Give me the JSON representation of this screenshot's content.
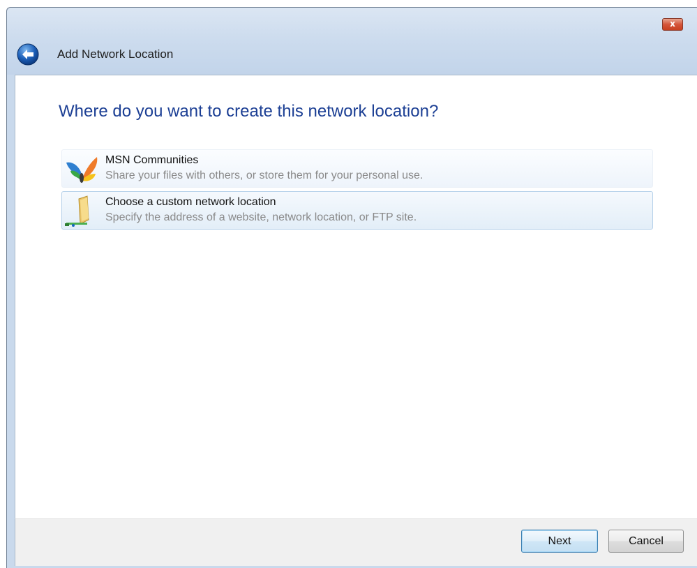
{
  "window": {
    "title": "Add Network Location",
    "close_label": "x"
  },
  "content": {
    "heading": "Where do you want to create this network location?",
    "options": [
      {
        "title": "MSN Communities",
        "description": "Share your files with others, or store them for your personal use.",
        "icon": "msn-butterfly-icon"
      },
      {
        "title": "Choose a custom network location",
        "description": "Specify the address of a website, network location, or FTP site.",
        "icon": "network-folder-icon",
        "selected": true
      }
    ]
  },
  "footer": {
    "next_label": "Next",
    "cancel_label": "Cancel"
  },
  "colors": {
    "heading": "#1c3f94",
    "title_bar": "#c9d9ec",
    "selected_option": "#e3eef8"
  }
}
